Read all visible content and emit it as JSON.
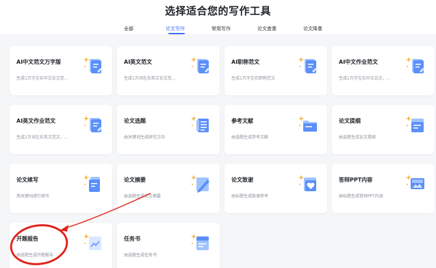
{
  "page": {
    "title": "选择适合您的写作工具"
  },
  "tabs": [
    {
      "label": "全部",
      "active": false
    },
    {
      "label": "论文写作",
      "active": true
    },
    {
      "label": "常用写作",
      "active": false
    },
    {
      "label": "论文查重",
      "active": false
    },
    {
      "label": "论文降重",
      "active": false
    }
  ],
  "colors": {
    "accent": "#3b6ff5",
    "icon_light": "#9fc3ff",
    "icon_main": "#5b8ff9",
    "sparkle": "#f5b63c",
    "annotation": "#e0231b"
  },
  "cards": [
    {
      "title": "AI中文范文万字版",
      "desc": "生成1万字左右中文论文范…",
      "icon": "document-edit-icon"
    },
    {
      "title": "AI英文范文",
      "desc": "生成1万词左右英文论文范…",
      "icon": "document-edit-icon"
    },
    {
      "title": "AI职称范文",
      "desc": "生成1万字左右职称范文",
      "icon": "document-edit-icon"
    },
    {
      "title": "AI中文作业范文",
      "desc": "生成1万字左右中文论文，…",
      "icon": "document-edit-icon"
    },
    {
      "title": "AI英文作业范文",
      "desc": "生成1万词左右英文范文，…",
      "icon": "document-edit-icon"
    },
    {
      "title": "论文选题",
      "desc": "由关键词生成研究方向",
      "icon": "list-icon"
    },
    {
      "title": "参考文献",
      "desc": "由选题生成参考文献",
      "icon": "folder-icon"
    },
    {
      "title": "论文提纲",
      "desc": "由选题生成论文提纲",
      "icon": "outline-icon"
    },
    {
      "title": "论文续写",
      "desc": "用关键词进行续写",
      "icon": "continue-write-icon"
    },
    {
      "title": "论文摘要",
      "desc": "由选题生成论文摘要",
      "icon": "pen-document-icon"
    },
    {
      "title": "论文致谢",
      "desc": "由标题生成致谢参考",
      "icon": "heart-document-icon"
    },
    {
      "title": "答辩PPT内容",
      "desc": "由标题生成答辩PPT内容",
      "icon": "presentation-icon"
    },
    {
      "title": "开题报告",
      "desc": "由选题生成开题报告",
      "icon": "chart-document-icon"
    },
    {
      "title": "任务书",
      "desc": "由选题生成任务书",
      "icon": "task-document-icon"
    }
  ]
}
